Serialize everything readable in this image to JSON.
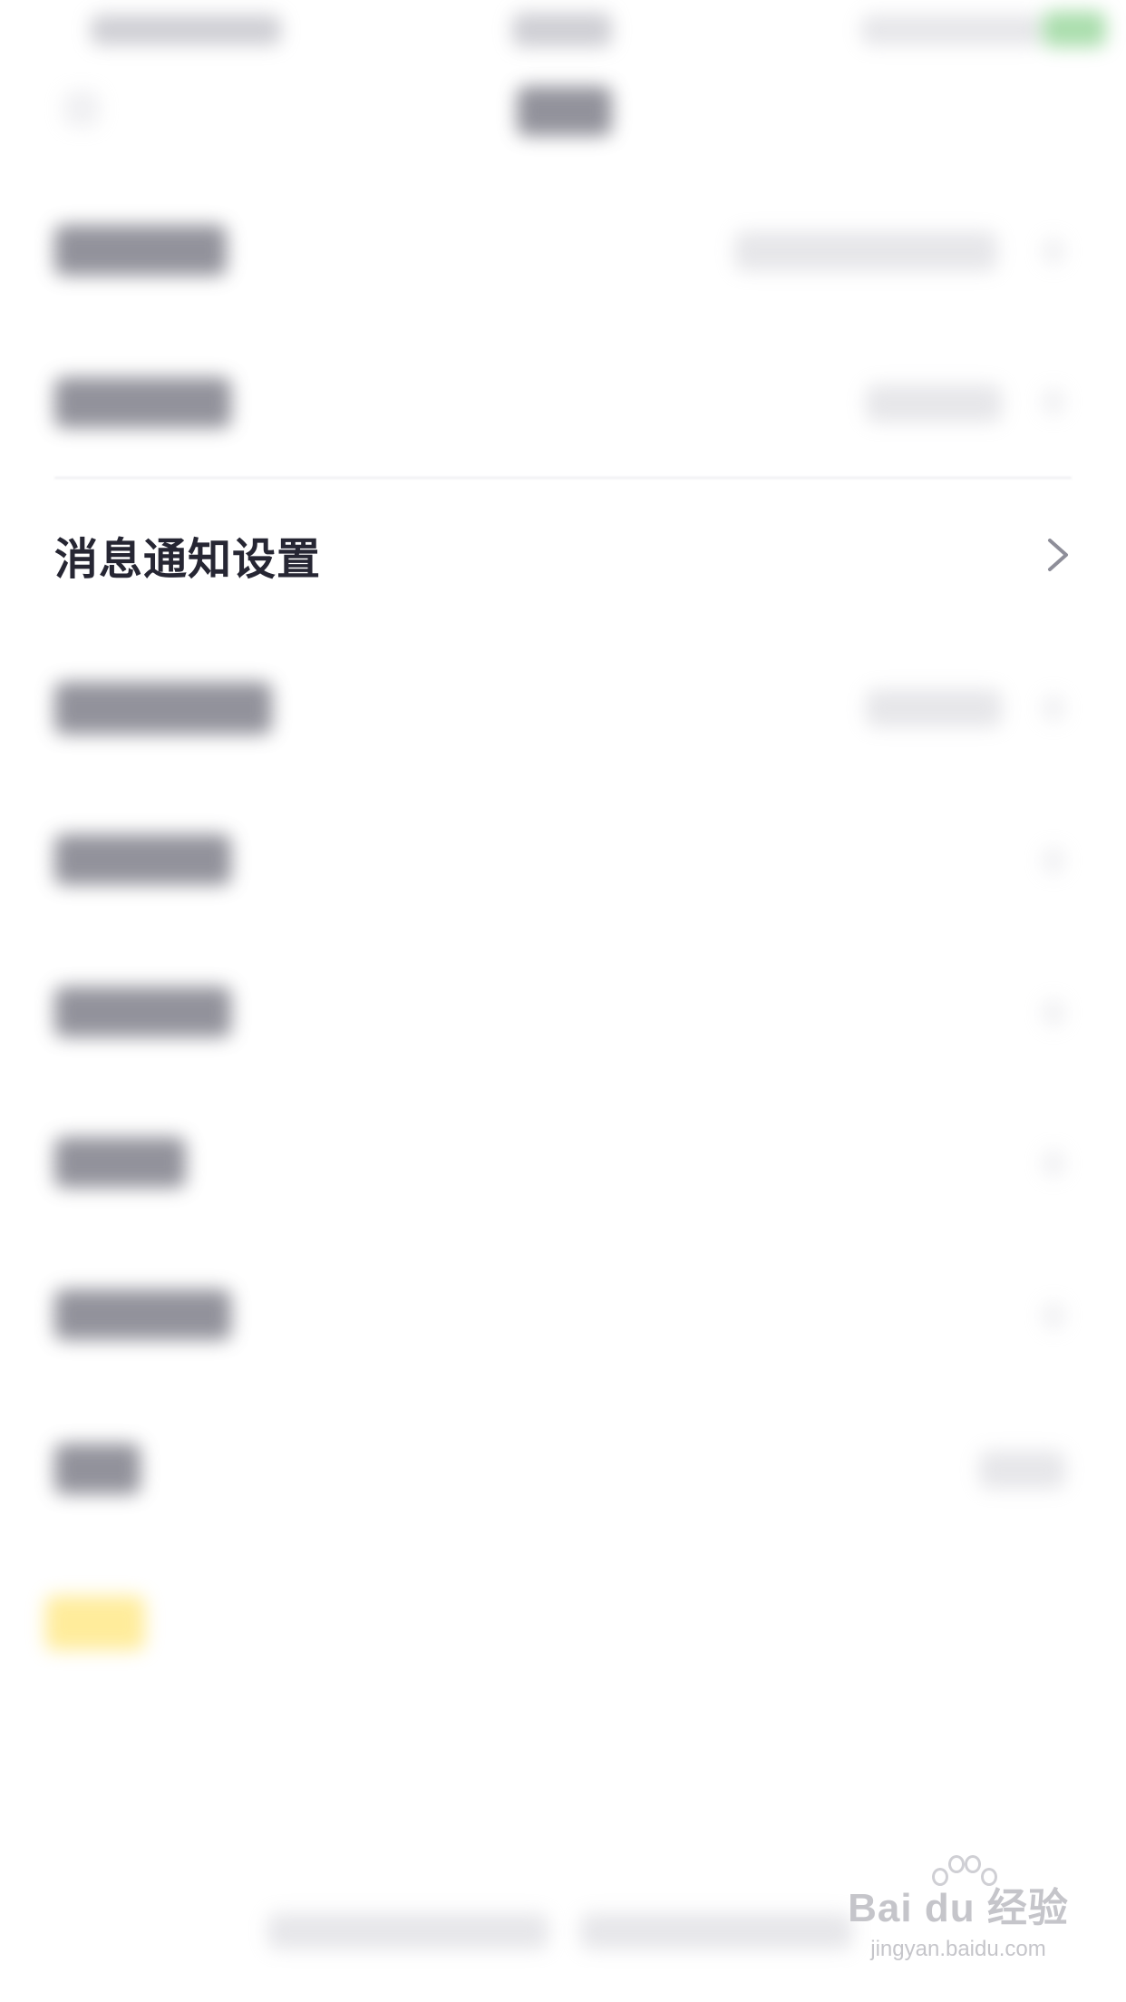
{
  "screen": {
    "title": "消息通知设置"
  },
  "focused_row": {
    "label": "消息通知设置",
    "chevron_icon": "chevron-right-icon"
  },
  "watermark": {
    "brand": "Bai du 经验",
    "url": "jingyan.baidu.com"
  },
  "colors": {
    "background": "#ffffff",
    "label_text": "#262633",
    "chevron": "#8e8e99",
    "watermark": "#c5c5ca"
  }
}
